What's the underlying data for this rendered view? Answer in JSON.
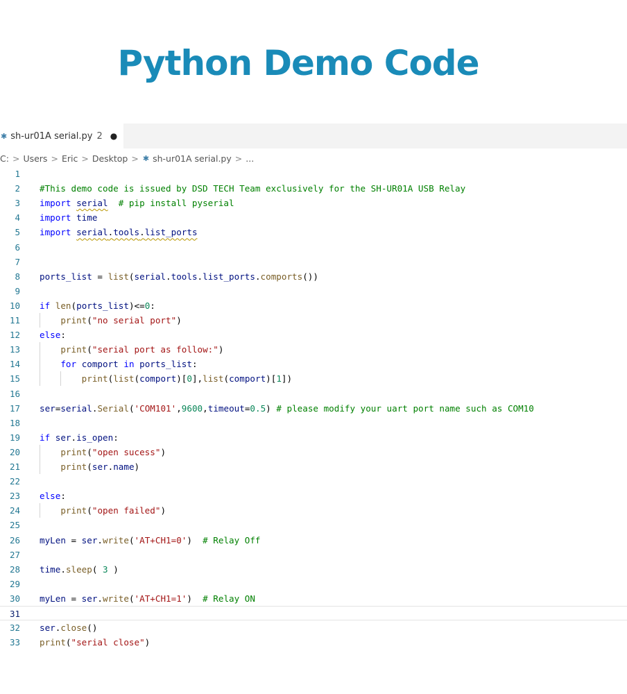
{
  "headline": "Python Demo Code",
  "tab": {
    "title": "sh-ur01A serial.py",
    "problem_count": "2",
    "dirty_indicator": "●",
    "icon": "python-file-icon"
  },
  "breadcrumb": {
    "items": [
      "C:",
      "Users",
      "Eric",
      "Desktop",
      "sh-ur01A serial.py",
      "..."
    ],
    "separator": ">"
  },
  "editor": {
    "current_line": 31,
    "lines": [
      {
        "n": "1",
        "text": ""
      },
      {
        "n": "2",
        "text": "#This demo code is issued by DSD TECH Team exclusively for the SH-UR01A USB Relay"
      },
      {
        "n": "3",
        "text": "import serial  # pip install pyserial"
      },
      {
        "n": "4",
        "text": "import time"
      },
      {
        "n": "5",
        "text": "import serial.tools.list_ports"
      },
      {
        "n": "6",
        "text": ""
      },
      {
        "n": "7",
        "text": ""
      },
      {
        "n": "8",
        "text": "ports_list = list(serial.tools.list_ports.comports())"
      },
      {
        "n": "9",
        "text": ""
      },
      {
        "n": "10",
        "text": "if len(ports_list)<=0:"
      },
      {
        "n": "11",
        "text": "    print(\"no serial port\")"
      },
      {
        "n": "12",
        "text": "else:"
      },
      {
        "n": "13",
        "text": "    print(\"serial port as follow:\")"
      },
      {
        "n": "14",
        "text": "    for comport in ports_list:"
      },
      {
        "n": "15",
        "text": "        print(list(comport)[0],list(comport)[1])"
      },
      {
        "n": "16",
        "text": ""
      },
      {
        "n": "17",
        "text": "ser=serial.Serial('COM101',9600,timeout=0.5) # please modify your uart port name such as COM10"
      },
      {
        "n": "18",
        "text": ""
      },
      {
        "n": "19",
        "text": "if ser.is_open:"
      },
      {
        "n": "20",
        "text": "    print(\"open sucess\")"
      },
      {
        "n": "21",
        "text": "    print(ser.name)"
      },
      {
        "n": "22",
        "text": ""
      },
      {
        "n": "23",
        "text": "else:"
      },
      {
        "n": "24",
        "text": "    print(\"open failed\")"
      },
      {
        "n": "25",
        "text": ""
      },
      {
        "n": "26",
        "text": "myLen = ser.write('AT+CH1=0')  # Relay Off"
      },
      {
        "n": "27",
        "text": ""
      },
      {
        "n": "28",
        "text": "time.sleep( 3 )"
      },
      {
        "n": "29",
        "text": ""
      },
      {
        "n": "30",
        "text": "myLen = ser.write('AT+CH1=1')  # Relay ON"
      },
      {
        "n": "31",
        "text": ""
      },
      {
        "n": "32",
        "text": "ser.close()"
      },
      {
        "n": "33",
        "text": "print(\"serial close\")"
      }
    ]
  },
  "colors": {
    "headline": "#1a8bb8",
    "keyword": "#0000ff",
    "function": "#795e26",
    "string": "#a31515",
    "number": "#098658",
    "comment": "#008000",
    "line_number": "#237893"
  }
}
